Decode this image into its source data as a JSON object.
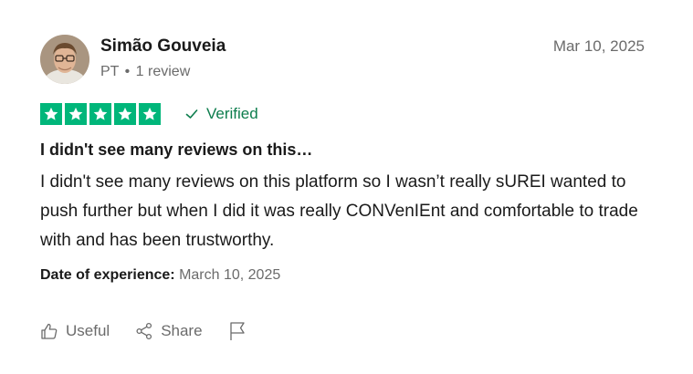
{
  "reviewer": {
    "name": "Simão Gouveia",
    "country": "PT",
    "separator": "•",
    "review_count": "1 review"
  },
  "review_date": "Mar 10, 2025",
  "rating": {
    "stars": 5,
    "out_of": 5,
    "color": "#00b67a"
  },
  "verified_label": "Verified",
  "review": {
    "title": "I didn't see many reviews on this…",
    "body": "I didn't see many reviews on this platform so I wasn’t really sUREI wanted to push further but when I did it was really CONVenIEnt and comfortable to trade with and has been trustworthy."
  },
  "experience": {
    "label": "Date of experience:",
    "value": "March 10, 2025"
  },
  "actions": {
    "useful_label": "Useful",
    "share_label": "Share"
  },
  "icons": [
    "thumbs-up-icon",
    "share-icon",
    "flag-icon",
    "check-icon",
    "star-icon"
  ],
  "colors": {
    "accent_green": "#00b67a",
    "verified_green": "#0d7d4d",
    "muted_text": "#6b6b6b"
  }
}
